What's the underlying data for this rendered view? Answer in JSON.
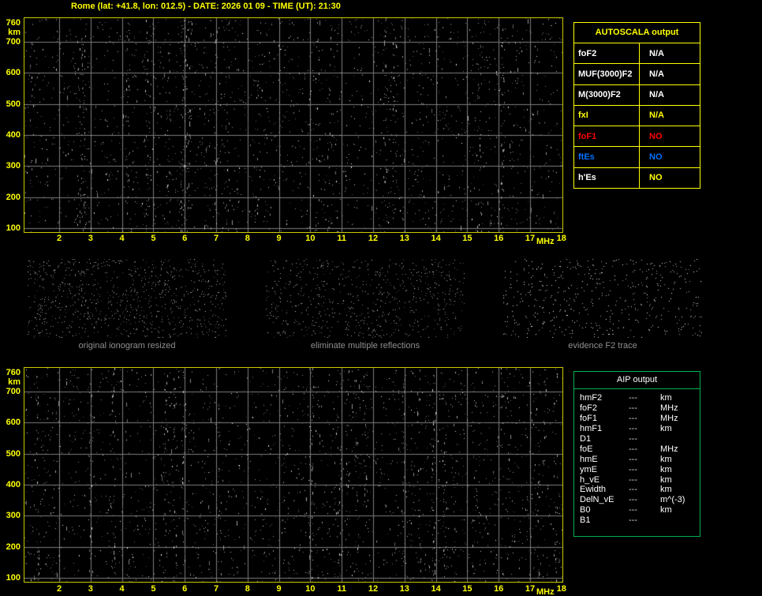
{
  "header": {
    "title": "Rome (lat: +41.8, lon: 012.5) - DATE: 2026 01 09 - TIME (UT): 21:30"
  },
  "colors": {
    "accent_yellow": "#FFFF00",
    "plot_border": "#C9C900",
    "grid_gray": "#7C7C7C",
    "aip_green": "#00B050",
    "foF1_red": "#FF0000",
    "ftEs_blue": "#0070FF",
    "panel_label_gray": "#8F8F8F"
  },
  "ionogram_axes": {
    "x_ticks": [
      "2",
      "3",
      "4",
      "5",
      "6",
      "7",
      "8",
      "9",
      "10",
      "11",
      "12",
      "13",
      "14",
      "15",
      "16",
      "17",
      "18"
    ],
    "x_unit": "MHz",
    "y_ticks": [
      "760",
      "km",
      "700",
      "600",
      "500",
      "400",
      "300",
      "200",
      "100"
    ],
    "x_range_mhz": [
      2,
      18
    ],
    "y_range_km": [
      100,
      760
    ]
  },
  "autoscala": {
    "title": "AUTOSCALA output",
    "rows": [
      {
        "label": "foF2",
        "value": "N/A",
        "label_color": "#FFFFFF",
        "value_color": "#FFFFFF"
      },
      {
        "label": "MUF(3000)F2",
        "value": "N/A",
        "label_color": "#FFFFFF",
        "value_color": "#FFFFFF"
      },
      {
        "label": "M(3000)F2",
        "value": "N/A",
        "label_color": "#FFFFFF",
        "value_color": "#FFFFFF"
      },
      {
        "label": "fxI",
        "value": "N/A",
        "label_color": "#FFFF00",
        "value_color": "#FFFF00"
      },
      {
        "label": "foF1",
        "value": "NO",
        "label_color": "#FF0000",
        "value_color": "#FF0000"
      },
      {
        "label": "ftEs",
        "value": "NO",
        "label_color": "#0070FF",
        "value_color": "#0070FF"
      },
      {
        "label": "h'Es",
        "value": "NO",
        "label_color": "#FFFFFF",
        "value_color": "#FFFF00"
      }
    ]
  },
  "panels": [
    {
      "label": "original ionogram resized"
    },
    {
      "label": "eliminate multiple reflections"
    },
    {
      "label": "evidence F2 trace"
    }
  ],
  "aip": {
    "title": "AIP output",
    "rows": [
      {
        "name": "hmF2",
        "value": "---",
        "unit": "km"
      },
      {
        "name": "foF2",
        "value": "---",
        "unit": "MHz"
      },
      {
        "name": "foF1",
        "value": "---",
        "unit": "MHz"
      },
      {
        "name": "hmF1",
        "value": "---",
        "unit": "km"
      },
      {
        "name": "D1",
        "value": "---",
        "unit": ""
      },
      {
        "name": "foE",
        "value": "---",
        "unit": "MHz"
      },
      {
        "name": "hmE",
        "value": "---",
        "unit": "km"
      },
      {
        "name": "ymE",
        "value": "---",
        "unit": "km"
      },
      {
        "name": "h_vE",
        "value": "---",
        "unit": "km"
      },
      {
        "name": "Ewidth",
        "value": "---",
        "unit": "km"
      },
      {
        "name": "DelN_vE",
        "value": "---",
        "unit": "m^(-3)"
      },
      {
        "name": "B0",
        "value": "---",
        "unit": "km"
      },
      {
        "name": "B1",
        "value": "---",
        "unit": ""
      }
    ]
  },
  "chart_data": [
    {
      "type": "scatter",
      "title": "raw ionogram",
      "xlabel": "MHz",
      "ylabel": "km",
      "xlim": [
        2,
        18
      ],
      "ylim": [
        100,
        760
      ],
      "grid": true,
      "series": []
    },
    {
      "type": "scatter",
      "title": "processed ionogram",
      "xlabel": "MHz",
      "ylabel": "km",
      "xlim": [
        2,
        18
      ],
      "ylim": [
        100,
        760
      ],
      "grid": true,
      "series": []
    }
  ]
}
